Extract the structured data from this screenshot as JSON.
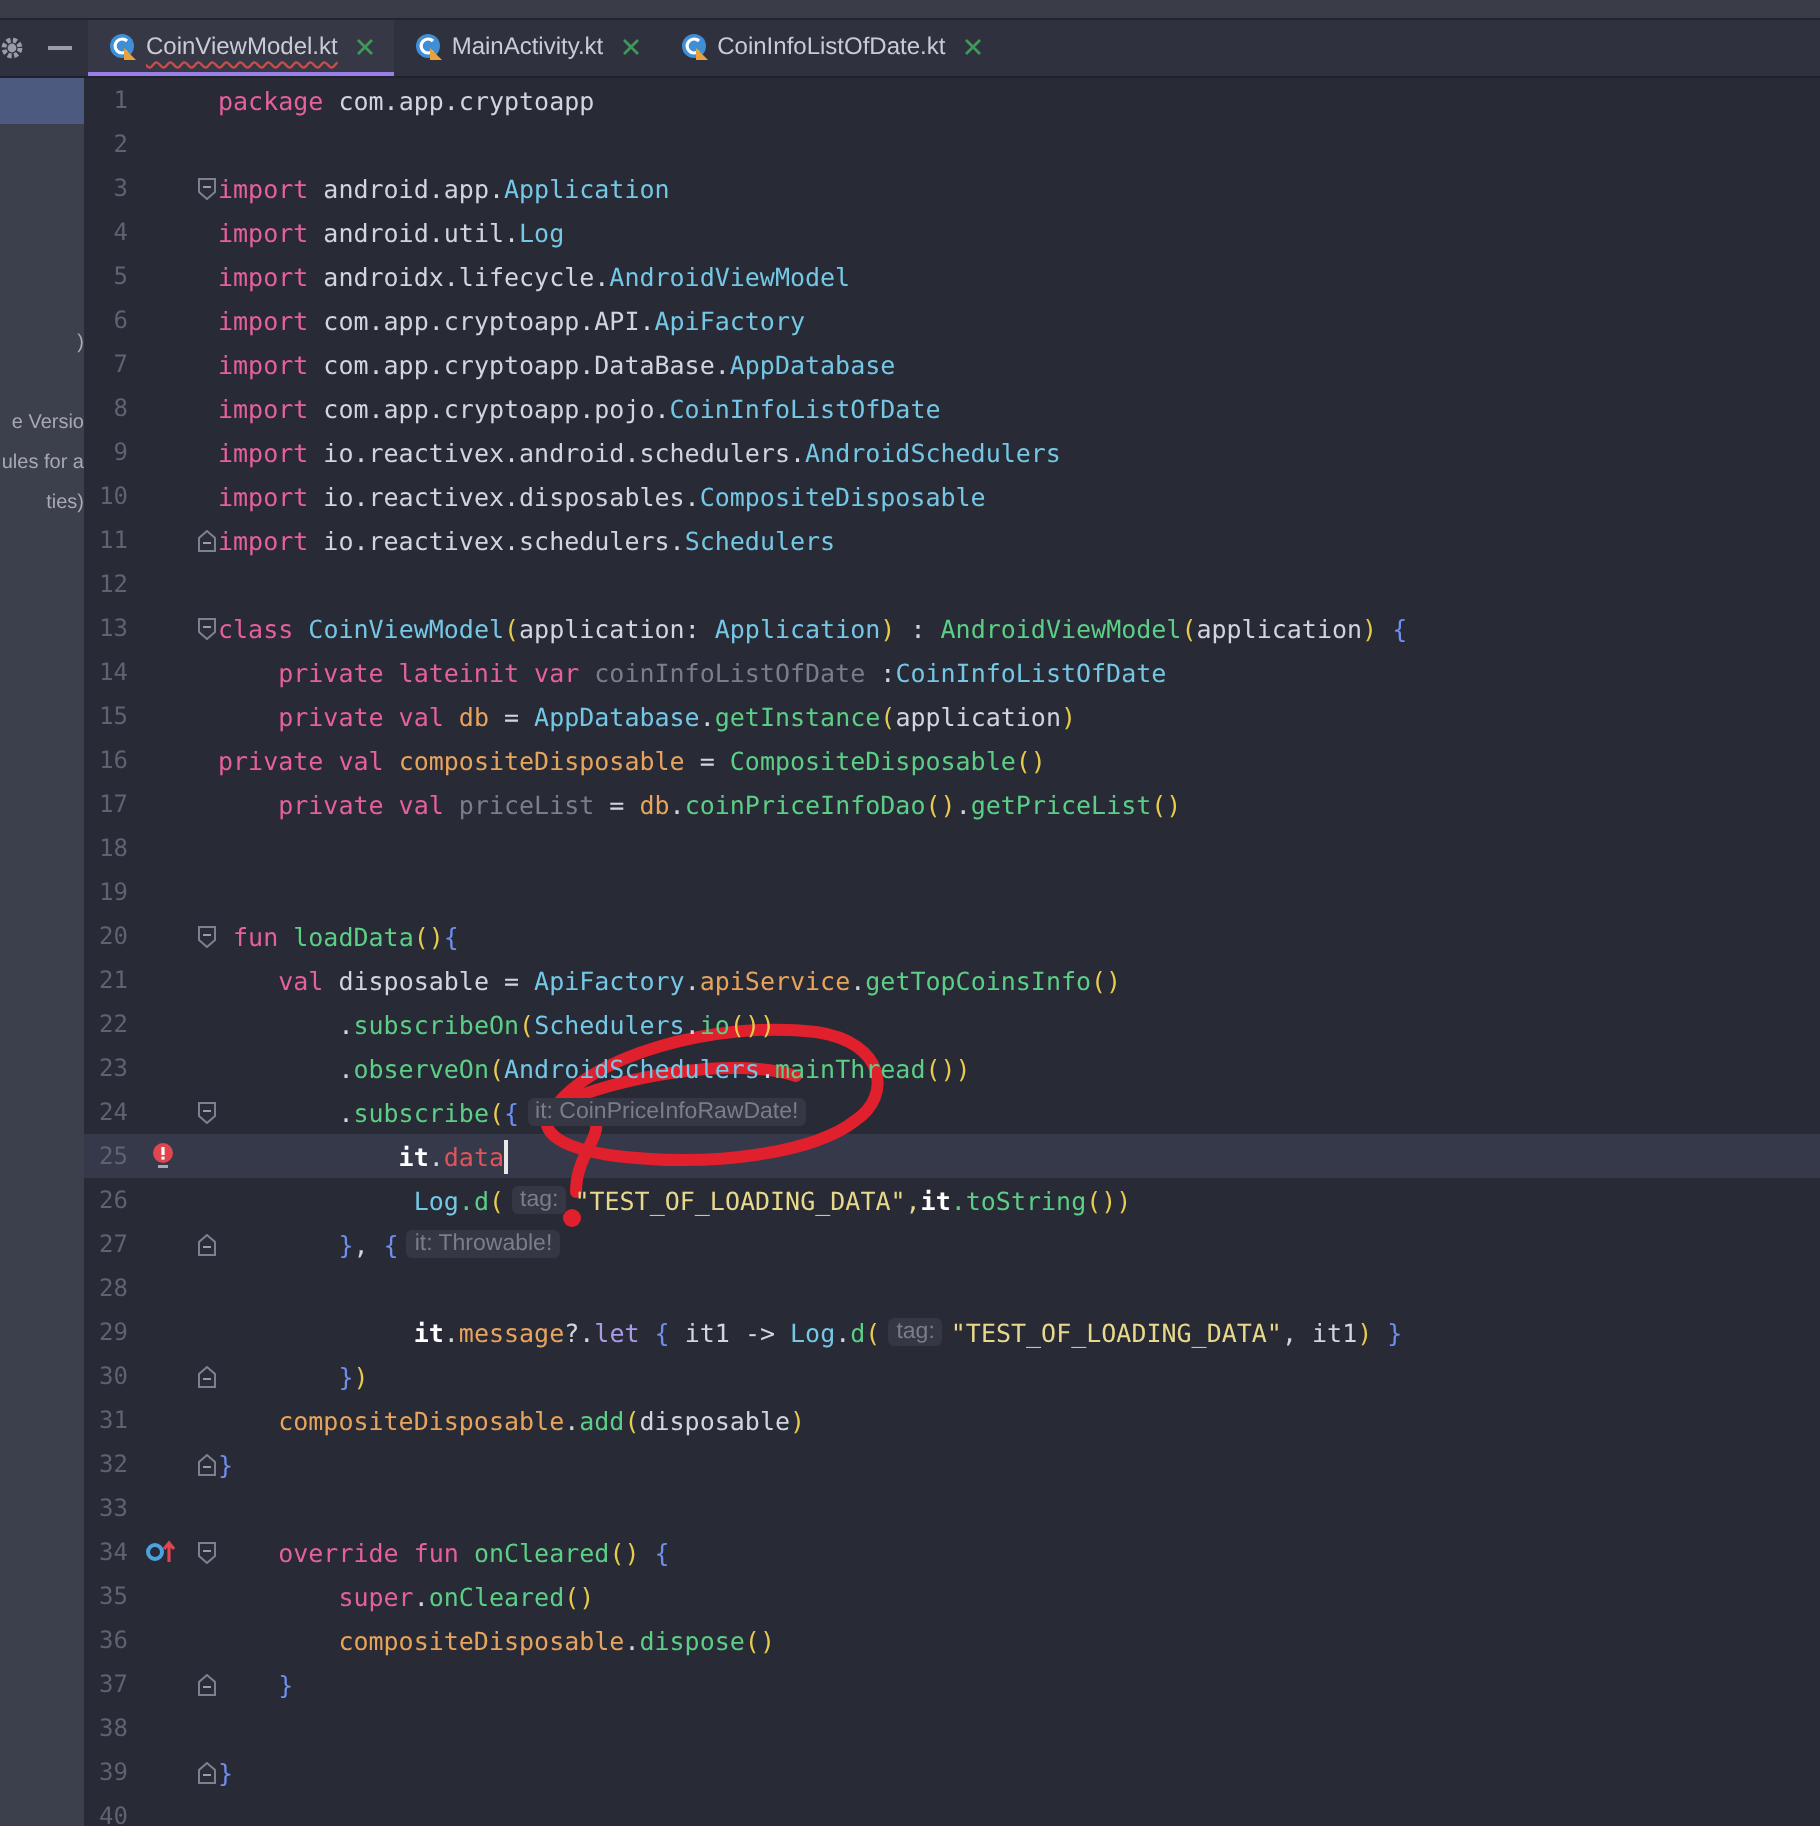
{
  "tabs": [
    {
      "label": "CoinViewModel.kt",
      "selected": true
    },
    {
      "label": "MainActivity.kt",
      "selected": false
    },
    {
      "label": "CoinInfoListOfDate.kt",
      "selected": false
    }
  ],
  "sidebar": {
    "selected_row": true,
    "items": [
      ")",
      "e Versio",
      "ules for a",
      "ties)"
    ]
  },
  "editor": {
    "lines": [
      {
        "n": "1",
        "current": false,
        "tokens": [
          {
            "kind": "kw",
            "t": "package"
          },
          {
            "kind": "plain",
            "t": " com.app.cryptoapp"
          }
        ]
      },
      {
        "n": "2",
        "current": false
      },
      {
        "n": "3",
        "current": false,
        "fold": {
          "kind": "start"
        },
        "tokens": [
          {
            "kind": "kw",
            "t": "import"
          },
          {
            "kind": "plain",
            "t": " android.app."
          },
          {
            "kind": "cls",
            "t": "Application"
          }
        ]
      },
      {
        "n": "4",
        "current": false,
        "tokens": [
          {
            "kind": "kw",
            "t": "import"
          },
          {
            "kind": "plain",
            "t": " android.util."
          },
          {
            "kind": "cls",
            "t": "Log"
          }
        ]
      },
      {
        "n": "5",
        "current": false,
        "tokens": [
          {
            "kind": "kw",
            "t": "import"
          },
          {
            "kind": "plain",
            "t": " androidx.lifecycle."
          },
          {
            "kind": "cls",
            "t": "AndroidViewModel"
          }
        ]
      },
      {
        "n": "6",
        "current": false,
        "tokens": [
          {
            "kind": "kw",
            "t": "import"
          },
          {
            "kind": "plain",
            "t": " com.app.cryptoapp.API."
          },
          {
            "kind": "cls",
            "t": "ApiFactory"
          }
        ]
      },
      {
        "n": "7",
        "current": false,
        "tokens": [
          {
            "kind": "kw",
            "t": "import"
          },
          {
            "kind": "plain",
            "t": " com.app.cryptoapp.DataBase."
          },
          {
            "kind": "cls",
            "t": "AppDatabase"
          }
        ]
      },
      {
        "n": "8",
        "current": false,
        "tokens": [
          {
            "kind": "kw",
            "t": "import"
          },
          {
            "kind": "plain",
            "t": " com.app.cryptoapp.pojo."
          },
          {
            "kind": "cls",
            "t": "CoinInfoListOfDate"
          }
        ]
      },
      {
        "n": "9",
        "current": false,
        "tokens": [
          {
            "kind": "kw",
            "t": "import"
          },
          {
            "kind": "plain",
            "t": " io.reactivex.android.schedulers."
          },
          {
            "kind": "cls",
            "t": "AndroidSchedulers"
          }
        ]
      },
      {
        "n": "10",
        "current": false,
        "tokens": [
          {
            "kind": "kw",
            "t": "import"
          },
          {
            "kind": "plain",
            "t": " io.reactivex.disposables."
          },
          {
            "kind": "cls",
            "t": "CompositeDisposable"
          }
        ]
      },
      {
        "n": "11",
        "current": false,
        "fold": {
          "kind": "end"
        },
        "tokens": [
          {
            "kind": "kw",
            "t": "import"
          },
          {
            "kind": "plain",
            "t": " io.reactivex.schedulers."
          },
          {
            "kind": "cls",
            "t": "Schedulers"
          }
        ]
      },
      {
        "n": "12",
        "current": false
      },
      {
        "n": "13",
        "current": false,
        "fold": {
          "kind": "start"
        },
        "tokens": [
          {
            "kind": "kw",
            "t": "class"
          },
          {
            "kind": "cls",
            "t": " CoinViewModel"
          },
          {
            "kind": "paren",
            "t": "("
          },
          {
            "kind": "plain",
            "t": "application: "
          },
          {
            "kind": "cls",
            "t": "Application"
          },
          {
            "kind": "paren",
            "t": ")"
          },
          {
            "kind": "plain",
            "t": " : "
          },
          {
            "kind": "fn",
            "t": "AndroidViewModel"
          },
          {
            "kind": "paren",
            "t": "("
          },
          {
            "kind": "plain",
            "t": "application"
          },
          {
            "kind": "paren",
            "t": ")"
          },
          {
            "kind": "brace",
            "t": " {"
          }
        ]
      },
      {
        "n": "14",
        "current": false,
        "tokens": [
          {
            "kind": "kw",
            "t": "    private lateinit var"
          },
          {
            "kind": "unused",
            "t": " coinInfoListOfDate"
          },
          {
            "kind": "plain",
            "t": " :"
          },
          {
            "kind": "cls",
            "t": "CoinInfoListOfDate"
          }
        ]
      },
      {
        "n": "15",
        "current": false,
        "tokens": [
          {
            "kind": "kw",
            "t": "    private val"
          },
          {
            "kind": "prop",
            "t": " db"
          },
          {
            "kind": "plain",
            "t": " = "
          },
          {
            "kind": "cls",
            "t": "AppDatabase"
          },
          {
            "kind": "plain",
            "t": "."
          },
          {
            "kind": "fn",
            "t": "getInstance"
          },
          {
            "kind": "paren",
            "t": "("
          },
          {
            "kind": "plain",
            "t": "application"
          },
          {
            "kind": "paren",
            "t": ")"
          }
        ]
      },
      {
        "n": "16",
        "current": false,
        "tokens": [
          {
            "kind": "kw",
            "t": "private val"
          },
          {
            "kind": "prop",
            "t": " compositeDisposable"
          },
          {
            "kind": "plain",
            "t": " = "
          },
          {
            "kind": "fn",
            "t": "CompositeDisposable"
          },
          {
            "kind": "paren",
            "t": "()"
          }
        ]
      },
      {
        "n": "17",
        "current": false,
        "tokens": [
          {
            "kind": "kw",
            "t": "    private val"
          },
          {
            "kind": "unused",
            "t": " priceList"
          },
          {
            "kind": "plain",
            "t": " = "
          },
          {
            "kind": "prop",
            "t": "db"
          },
          {
            "kind": "plain",
            "t": "."
          },
          {
            "kind": "fn",
            "t": "coinPriceInfoDao"
          },
          {
            "kind": "paren",
            "t": "()"
          },
          {
            "kind": "plain",
            "t": "."
          },
          {
            "kind": "fn",
            "t": "getPriceList"
          },
          {
            "kind": "paren",
            "t": "()"
          }
        ]
      },
      {
        "n": "18",
        "current": false
      },
      {
        "n": "19",
        "current": false
      },
      {
        "n": "20",
        "current": false,
        "fold": {
          "kind": "start"
        },
        "tokens": [
          {
            "kind": "kw",
            "t": " fun"
          },
          {
            "kind": "fn",
            "t": " loadData"
          },
          {
            "kind": "paren",
            "t": "()"
          },
          {
            "kind": "brace",
            "t": "{"
          }
        ]
      },
      {
        "n": "21",
        "current": false,
        "tokens": [
          {
            "kind": "kw",
            "t": "    val"
          },
          {
            "kind": "plain",
            "t": " disposable = "
          },
          {
            "kind": "cls",
            "t": "ApiFactory"
          },
          {
            "kind": "plain",
            "t": "."
          },
          {
            "kind": "prop",
            "t": "apiService"
          },
          {
            "kind": "plain",
            "t": "."
          },
          {
            "kind": "fn",
            "t": "getTopCoinsInfo"
          },
          {
            "kind": "paren",
            "t": "()"
          }
        ]
      },
      {
        "n": "22",
        "current": false,
        "tokens": [
          {
            "kind": "plain",
            "t": "        ."
          },
          {
            "kind": "fn",
            "t": "subscribeOn"
          },
          {
            "kind": "paren",
            "t": "("
          },
          {
            "kind": "cls",
            "t": "Schedulers"
          },
          {
            "kind": "plain",
            "t": "."
          },
          {
            "kind": "fn",
            "t": "io"
          },
          {
            "kind": "paren",
            "t": "())"
          }
        ]
      },
      {
        "n": "23",
        "current": false,
        "tokens": [
          {
            "kind": "plain",
            "t": "        ."
          },
          {
            "kind": "fn",
            "t": "observeOn"
          },
          {
            "kind": "paren",
            "t": "("
          },
          {
            "kind": "cls",
            "t": "AndroidSchedulers"
          },
          {
            "kind": "plain",
            "t": "."
          },
          {
            "kind": "fn",
            "t": "mainThread"
          },
          {
            "kind": "paren",
            "t": "())"
          }
        ]
      },
      {
        "n": "24",
        "current": false,
        "fold": {
          "kind": "start"
        },
        "tokens": [
          {
            "kind": "plain",
            "t": "        ."
          },
          {
            "kind": "fn",
            "t": "subscribe"
          },
          {
            "kind": "paren",
            "t": "("
          },
          {
            "kind": "brace",
            "t": "{"
          },
          {
            "kind": "hint",
            "t": "it: CoinPriceInfoRawDate!"
          }
        ]
      },
      {
        "n": "25",
        "current": true,
        "gutter_icon": {
          "kind": "error"
        },
        "tokens": [
          {
            "kind": "it",
            "t": "            it"
          },
          {
            "kind": "plain",
            "t": "."
          },
          {
            "kind": "err",
            "t": "data"
          }
        ]
      },
      {
        "n": "26",
        "current": false,
        "tokens": [
          {
            "kind": "cls",
            "t": "             Log"
          },
          {
            "kind": "fn",
            "t": ".d"
          },
          {
            "kind": "paren",
            "t": "("
          },
          {
            "kind": "hint",
            "t": "tag:"
          },
          {
            "kind": "str",
            "t": "\"TEST_OF_LOADING_DATA\","
          },
          {
            "kind": "it",
            "t": "it"
          },
          {
            "kind": "fn",
            "t": ".toString"
          },
          {
            "kind": "paren",
            "t": "())"
          }
        ]
      },
      {
        "n": "27",
        "current": false,
        "fold": {
          "kind": "end"
        },
        "tokens": [
          {
            "kind": "brace",
            "t": "        }"
          },
          {
            "kind": "plain",
            "t": ", "
          },
          {
            "kind": "brace",
            "t": "{"
          },
          {
            "kind": "hint",
            "t": "it: Throwable!"
          }
        ]
      },
      {
        "n": "28",
        "current": false
      },
      {
        "n": "29",
        "current": false,
        "tokens": [
          {
            "kind": "it",
            "t": "             it"
          },
          {
            "kind": "plain",
            "t": "."
          },
          {
            "kind": "prop",
            "t": "message"
          },
          {
            "kind": "plain",
            "t": "?."
          },
          {
            "kind": "lav",
            "t": "let"
          },
          {
            "kind": "brace",
            "t": " {"
          },
          {
            "kind": "plain",
            "t": " it1 -> "
          },
          {
            "kind": "cls",
            "t": "Log"
          },
          {
            "kind": "plain",
            "t": "."
          },
          {
            "kind": "fn",
            "t": "d"
          },
          {
            "kind": "paren",
            "t": "("
          },
          {
            "kind": "hint",
            "t": "tag:"
          },
          {
            "kind": "str",
            "t": "\"TEST_OF_LOADING_DATA\""
          },
          {
            "kind": "plain",
            "t": ", it1"
          },
          {
            "kind": "paren",
            "t": ")"
          },
          {
            "kind": "brace",
            "t": " }"
          }
        ]
      },
      {
        "n": "30",
        "current": false,
        "fold": {
          "kind": "end"
        },
        "tokens": [
          {
            "kind": "brace",
            "t": "        }"
          },
          {
            "kind": "paren",
            "t": ")"
          }
        ]
      },
      {
        "n": "31",
        "current": false,
        "tokens": [
          {
            "kind": "prop",
            "t": "    compositeDisposable"
          },
          {
            "kind": "plain",
            "t": "."
          },
          {
            "kind": "fn",
            "t": "add"
          },
          {
            "kind": "paren",
            "t": "("
          },
          {
            "kind": "plain",
            "t": "disposable"
          },
          {
            "kind": "paren",
            "t": ")"
          }
        ]
      },
      {
        "n": "32",
        "current": false,
        "fold": {
          "kind": "end"
        },
        "tokens": [
          {
            "kind": "brace",
            "t": "}"
          }
        ]
      },
      {
        "n": "33",
        "current": false
      },
      {
        "n": "34",
        "current": false,
        "fold": {
          "kind": "start"
        },
        "gutter_icon": {
          "kind": "override"
        },
        "tokens": [
          {
            "kind": "kw",
            "t": "    override fun"
          },
          {
            "kind": "fn",
            "t": " onCleared"
          },
          {
            "kind": "paren",
            "t": "()"
          },
          {
            "kind": "brace",
            "t": " {"
          }
        ]
      },
      {
        "n": "35",
        "current": false,
        "tokens": [
          {
            "kind": "kw",
            "t": "        super"
          },
          {
            "kind": "plain",
            "t": "."
          },
          {
            "kind": "fn",
            "t": "onCleared"
          },
          {
            "kind": "paren",
            "t": "()"
          }
        ]
      },
      {
        "n": "36",
        "current": false,
        "tokens": [
          {
            "kind": "prop",
            "t": "        compositeDisposable"
          },
          {
            "kind": "plain",
            "t": "."
          },
          {
            "kind": "fn",
            "t": "dispose"
          },
          {
            "kind": "paren",
            "t": "()"
          }
        ]
      },
      {
        "n": "37",
        "current": false,
        "fold": {
          "kind": "end"
        },
        "tokens": [
          {
            "kind": "brace",
            "t": "    }"
          }
        ]
      },
      {
        "n": "38",
        "current": false
      },
      {
        "n": "39",
        "current": false,
        "fold": {
          "kind": "end"
        },
        "tokens": [
          {
            "kind": "brace",
            "t": "}"
          }
        ]
      },
      {
        "n": "40",
        "current": false
      }
    ]
  },
  "annotation": {
    "kind": "scribble"
  }
}
